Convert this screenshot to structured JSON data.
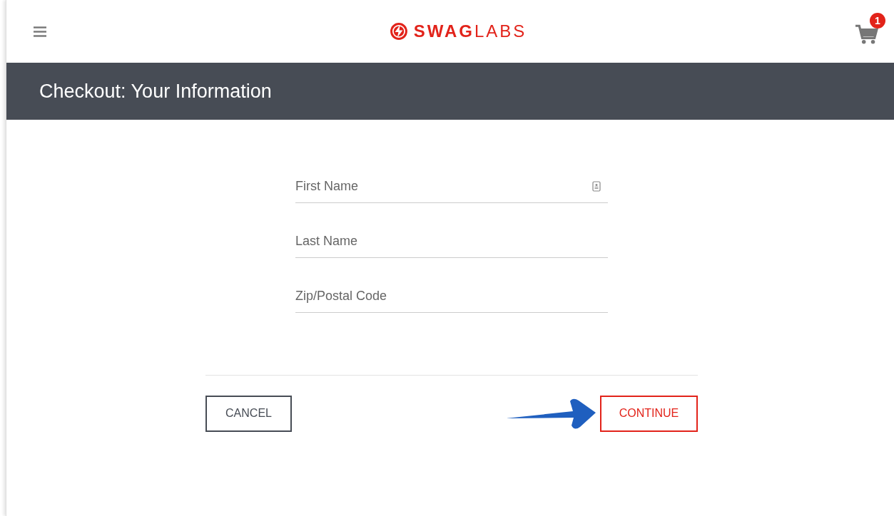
{
  "header": {
    "logo": "**SWAG**LABS",
    "cart": {
      "count": "1"
    }
  },
  "title_bar": {
    "title": "Checkout: Your Information"
  },
  "form": {
    "fields": [
      {
        "placeholder": "First Name",
        "autofill_icon": true
      },
      {
        "placeholder": "Last Name",
        "autofill_icon": false
      },
      {
        "placeholder": "Zip/Postal Code",
        "autofill_icon": false
      }
    ]
  },
  "buttons": [
    {
      "label": "CANCEL",
      "kind": "secondary"
    },
    {
      "label": "CONTINUE",
      "kind": "primary",
      "annotated": true
    }
  ]
}
